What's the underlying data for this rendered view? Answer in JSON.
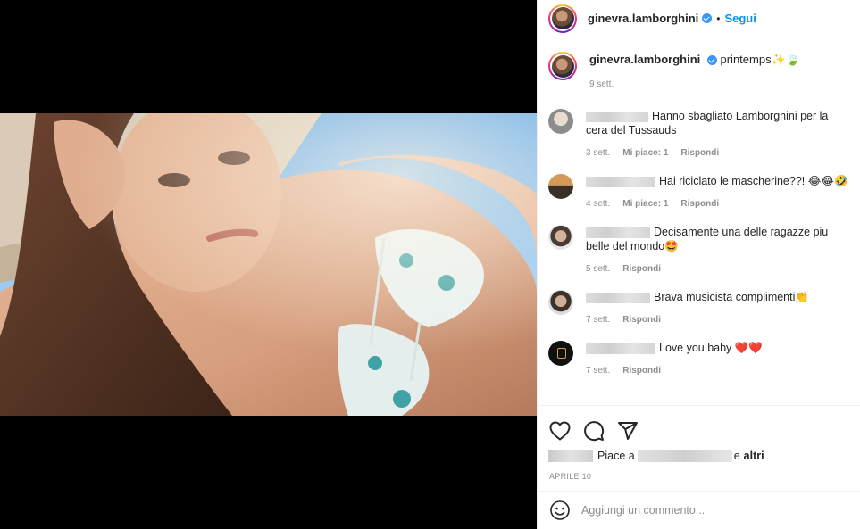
{
  "post": {
    "username": "ginevra.lamborghini",
    "follow_label": "Segui",
    "separator": "•",
    "caption": "printemps✨🍃",
    "caption_time": "9 sett."
  },
  "comments": [
    {
      "text": "Hanno sbagliato Lamborghini per la cera del Tussauds",
      "time": "3 sett.",
      "likes": "Mi piace: 1",
      "reply": "Rispondi"
    },
    {
      "text": "Hai riciclato le mascherine??! 😂😂🤣",
      "time": "4 sett.",
      "likes": "Mi piace: 1",
      "reply": "Rispondi"
    },
    {
      "text": "Decisamente una delle ragazze piu belle del mondo🤩",
      "time": "5 sett.",
      "likes": "",
      "reply": "Rispondi"
    },
    {
      "text": "Brava musicista complimenti👏",
      "time": "7 sett.",
      "likes": "",
      "reply": "Rispondi"
    },
    {
      "text": "Love you baby ❤️❤️",
      "time": "7 sett.",
      "likes": "",
      "reply": "Rispondi"
    }
  ],
  "likes_bar": {
    "prefix": "Piace a",
    "conjunction": "e",
    "others": "altri"
  },
  "post_date": "APRILE 10",
  "add_comment": {
    "placeholder": "Aggiungi un commento..."
  },
  "icons": {
    "like": "heart-icon",
    "comment": "comment-icon",
    "share": "paper-plane-icon",
    "emoji": "emoji-icon",
    "verified": "verified-badge-icon"
  },
  "colors": {
    "accent": "#0095f6",
    "verified": "#3897f0",
    "muted": "#8e8e8e",
    "text": "#262626"
  }
}
